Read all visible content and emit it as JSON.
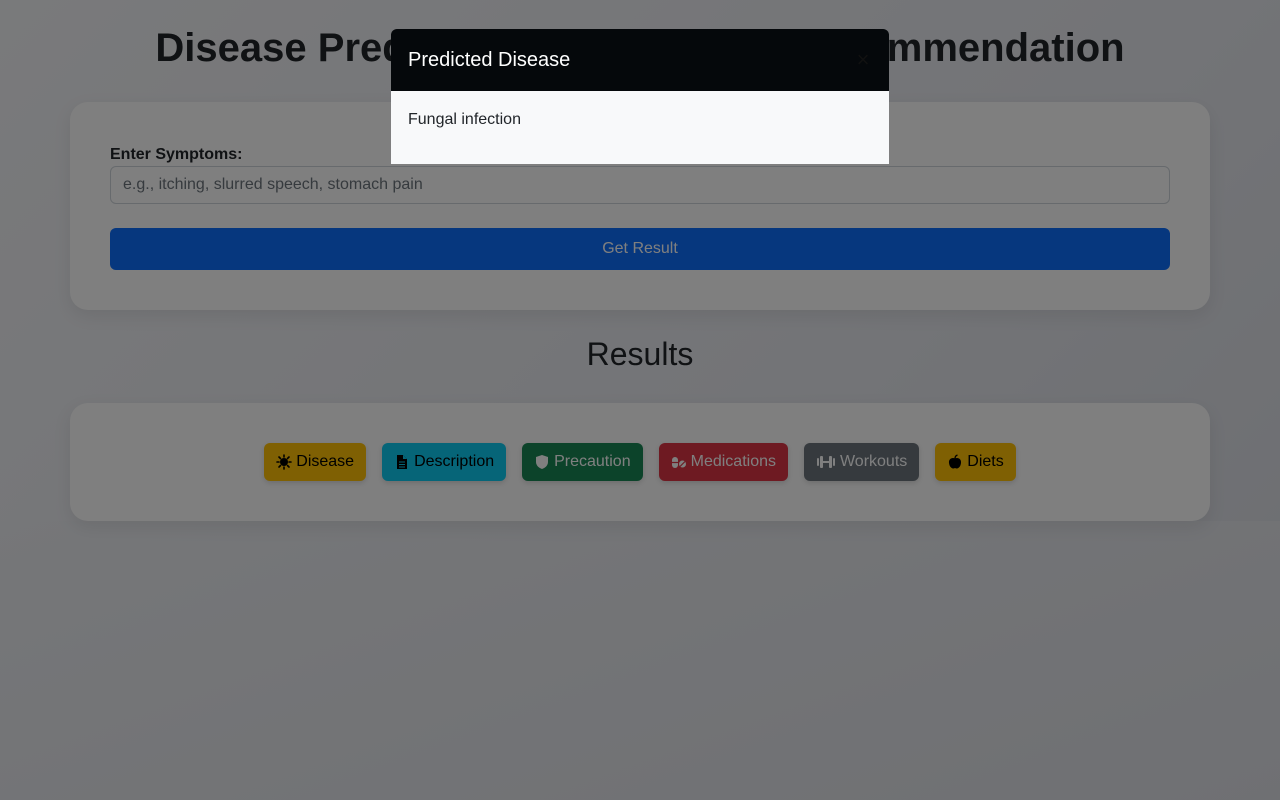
{
  "page": {
    "title": "Disease Prediction and Medicine Recommendation"
  },
  "form": {
    "label": "Enter Symptoms:",
    "placeholder": "e.g., itching, slurred speech, stomach pain",
    "value": "",
    "submit_label": "Get Result"
  },
  "results": {
    "heading": "Results",
    "buttons": [
      {
        "label": "Disease",
        "icon": "virus-icon",
        "color": "#ffc107"
      },
      {
        "label": "Description",
        "icon": "file-icon",
        "color": "#0dcaf0"
      },
      {
        "label": "Precaution",
        "icon": "shield-icon",
        "color": "#198754"
      },
      {
        "label": "Medications",
        "icon": "pills-icon",
        "color": "#dc3545"
      },
      {
        "label": "Workouts",
        "icon": "dumbbell-icon",
        "color": "#6c757d"
      },
      {
        "label": "Diets",
        "icon": "apple-icon",
        "color": "#ffc107"
      }
    ]
  },
  "modal": {
    "title": "Predicted Disease",
    "close_label": "×",
    "body": "Fungal infection"
  }
}
